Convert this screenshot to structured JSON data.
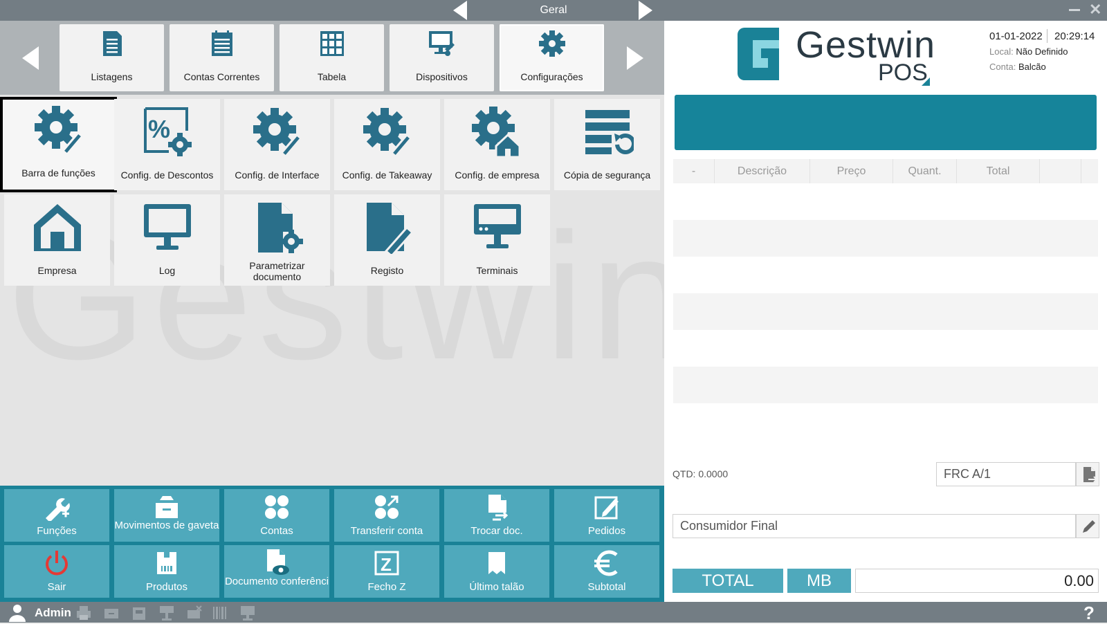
{
  "window": {
    "title": "Geral"
  },
  "categories": [
    {
      "label": "Listagens",
      "icon": "list-icon"
    },
    {
      "label": "Contas Correntes",
      "icon": "clipboard-list-icon"
    },
    {
      "label": "Tabela",
      "icon": "table-grid-icon"
    },
    {
      "label": "Dispositivos",
      "icon": "device-plug-icon"
    },
    {
      "label": "Configurações",
      "icon": "gear-icon",
      "active": true
    }
  ],
  "tiles": [
    {
      "label": "Barra de funções",
      "icon": "gear-brush-icon",
      "selected": true
    },
    {
      "label": "Config. de Descontos",
      "icon": "percent-gear-icon"
    },
    {
      "label": "Config. de Interface",
      "icon": "gear-brush-icon"
    },
    {
      "label": "Config. de Takeaway",
      "icon": "gear-brush-icon"
    },
    {
      "label": "Config. de empresa",
      "icon": "gear-house-icon"
    },
    {
      "label": "Cópia de segurança",
      "icon": "backup-restore-icon"
    },
    {
      "label": "Empresa",
      "icon": "house-icon"
    },
    {
      "label": "Log",
      "icon": "monitor-icon"
    },
    {
      "label": "Parametrizar documento",
      "icon": "document-gear-icon"
    },
    {
      "label": "Registo",
      "icon": "document-pencil-icon"
    },
    {
      "label": "Terminais",
      "icon": "terminal-icon"
    }
  ],
  "watermark": "Gestwin",
  "functions": [
    {
      "label": "Funções",
      "icon": "wrench-plus-icon"
    },
    {
      "label": "Movimentos de gaveta",
      "icon": "cash-drawer-icon"
    },
    {
      "label": "Contas",
      "icon": "four-dots-icon"
    },
    {
      "label": "Transferir conta",
      "icon": "transfer-dots-icon"
    },
    {
      "label": "Trocar doc.",
      "icon": "document-swap-icon"
    },
    {
      "label": "Pedidos",
      "icon": "edit-square-icon"
    },
    {
      "label": "Sair",
      "icon": "power-icon"
    },
    {
      "label": "Produtos",
      "icon": "product-box-icon"
    },
    {
      "label": "Documento conferênci",
      "icon": "document-eye-icon"
    },
    {
      "label": "Fecho Z",
      "icon": "z-box-icon"
    },
    {
      "label": "Último talão",
      "icon": "receipt-icon"
    },
    {
      "label": "Subtotal",
      "icon": "euro-icon"
    }
  ],
  "status": {
    "user": "Admin",
    "help": "?"
  },
  "brand": {
    "name": "Gestwin",
    "product": "POS",
    "accent": "#1a8297"
  },
  "session": {
    "date": "01-01-2022",
    "time": "20:29:14",
    "local_label": "Local:",
    "local_value": "Não Definido",
    "conta_label": "Conta:",
    "conta_value": "Balcão"
  },
  "grid": {
    "columns": [
      "-",
      "Descrição",
      "Preço",
      "Quant.",
      "Total"
    ]
  },
  "order": {
    "qtd": "QTD: 0.0000",
    "document": "FRC A/1",
    "customer": "Consumidor Final",
    "total_label": "TOTAL",
    "payment_label": "MB",
    "total_value": "0.00"
  }
}
